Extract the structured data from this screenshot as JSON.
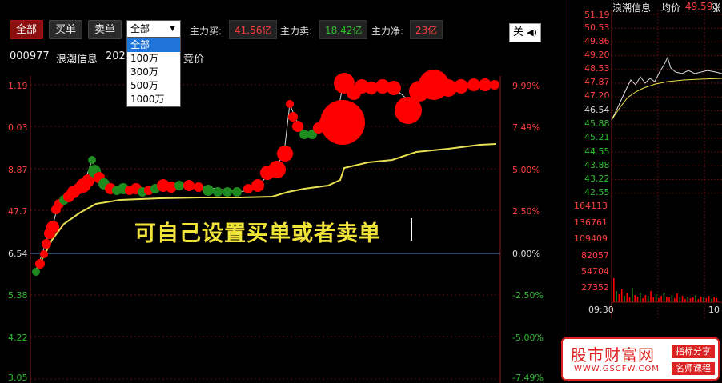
{
  "toolbar": {
    "all": "全部",
    "buy": "买单",
    "sell": "卖单",
    "select_value": "全部",
    "options": [
      "全部",
      "100万",
      "300万",
      "500万",
      "1000万"
    ],
    "main_buy_label": "主力买:",
    "main_buy_value": "41.56亿",
    "main_sell_label": "主力卖:",
    "main_sell_value": "18.42亿",
    "main_net_label": "主力净:",
    "main_net_value": "23亿",
    "mute_label": "关"
  },
  "stock": {
    "code": "000977",
    "name": "浪潮信息",
    "date_partial": "202",
    "auction": "竞价"
  },
  "left_axis": [
    "1.19",
    "0.03",
    "8.87",
    "47.7",
    "6.54",
    "5.38",
    "4.22",
    "3.05"
  ],
  "right_axis": [
    "9.99%",
    "7.49%",
    "5.00%",
    "2.50%",
    "0.00%",
    "-2.50%",
    "-5.00%",
    "-7.49%"
  ],
  "caption": "可自己设置买单或者卖单",
  "mini": {
    "title": "浪潮信息",
    "avg_label": "均价",
    "avg_value": "49.59",
    "tail": "涨",
    "price_axis": [
      "51.19",
      "50.53",
      "49.86",
      "49.20",
      "48.53",
      "47.87",
      "47.20",
      "46.54",
      "45.88",
      "45.21",
      "44.55",
      "43.88",
      "43.22",
      "42.55"
    ],
    "vol_axis": [
      "164113",
      "136761",
      "109409",
      "82057",
      "54704",
      "27352"
    ],
    "times": [
      "09:30",
      "10"
    ]
  },
  "watermark": {
    "brand": "股市财富网",
    "url": "WWW.GSCFW.COM",
    "tag1": "指标分享",
    "tag2": "名师课程"
  },
  "colors": {
    "up": "#ff0000",
    "down": "#1e8b1e",
    "avg_line": "#e8e050",
    "axis_red": "#ff4040",
    "axis_green": "#2fbf2f"
  }
}
